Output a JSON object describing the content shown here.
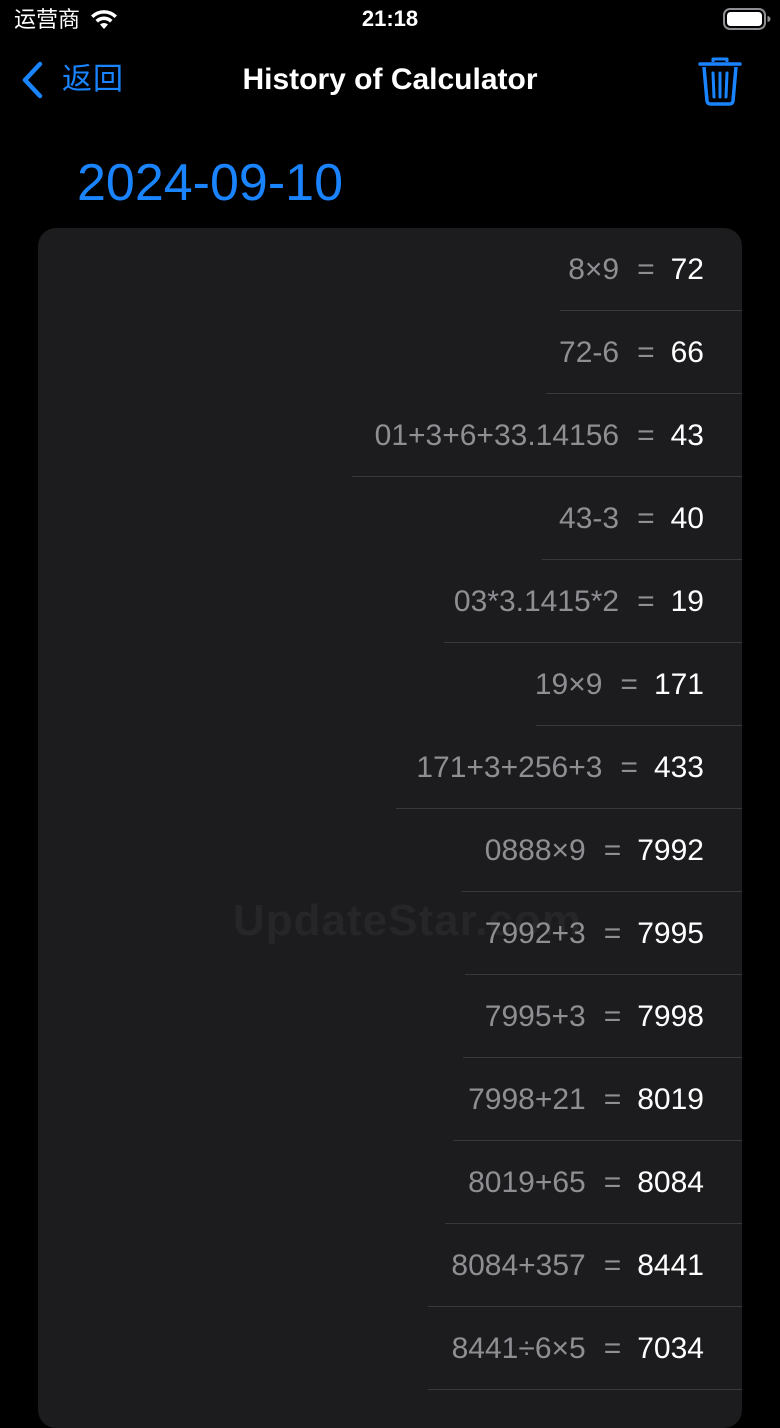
{
  "status_bar": {
    "carrier": "运营商",
    "time": "21:18"
  },
  "nav": {
    "back_label": "返回",
    "title": "History of Calculator"
  },
  "colors": {
    "accent": "#1a84ff",
    "background": "#000000",
    "card": "#1c1c1e",
    "expression_text": "#8e8e93",
    "result_text": "#ffffff"
  },
  "section": {
    "date": "2024-09-10"
  },
  "watermark": "UpdateStar.com",
  "history": [
    {
      "expression": "8×9",
      "equals": "=",
      "result": "72"
    },
    {
      "expression": "72-6",
      "equals": "=",
      "result": "66"
    },
    {
      "expression": "01+3+6+33.14156",
      "equals": "=",
      "result": "43"
    },
    {
      "expression": "43-3",
      "equals": "=",
      "result": "40"
    },
    {
      "expression": "03*3.1415*2",
      "equals": "=",
      "result": "19"
    },
    {
      "expression": "19×9",
      "equals": "=",
      "result": "171"
    },
    {
      "expression": "171+3+256+3",
      "equals": "=",
      "result": "433"
    },
    {
      "expression": "0888×9",
      "equals": "=",
      "result": "7992"
    },
    {
      "expression": "7992+3",
      "equals": "=",
      "result": "7995"
    },
    {
      "expression": "7995+3",
      "equals": "=",
      "result": "7998"
    },
    {
      "expression": "7998+21",
      "equals": "=",
      "result": "8019"
    },
    {
      "expression": "8019+65",
      "equals": "=",
      "result": "8084"
    },
    {
      "expression": "8084+357",
      "equals": "=",
      "result": "8441"
    },
    {
      "expression": "8441÷6×5",
      "equals": "=",
      "result": "7034"
    }
  ]
}
